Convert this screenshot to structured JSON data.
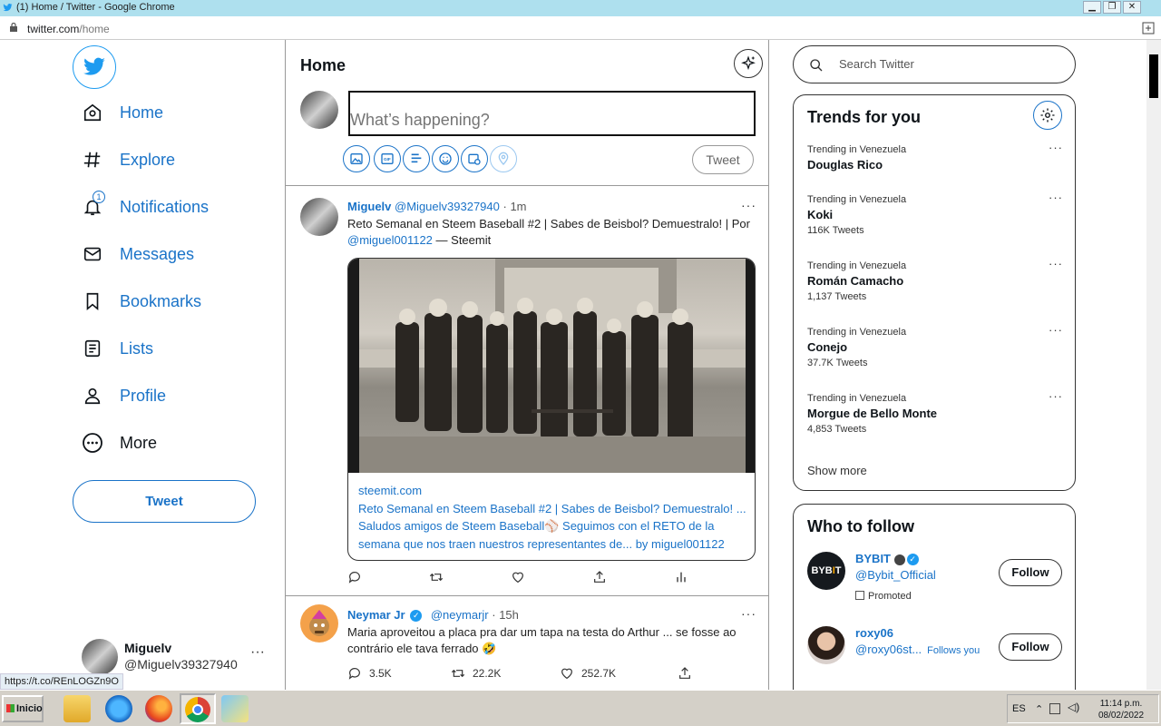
{
  "browser": {
    "window_title": "(1) Home / Twitter - Google Chrome",
    "url_host": "twitter.com",
    "url_path": "/home",
    "status_link": "https://t.co/REnLOGZn9O"
  },
  "colors": {
    "accent": "#1a73c8",
    "twitter_blue": "#1d9bf0",
    "titlebar": "#aee0ee"
  },
  "nav": {
    "items": [
      {
        "label": "Home",
        "icon": "home-icon"
      },
      {
        "label": "Explore",
        "icon": "hashtag-icon"
      },
      {
        "label": "Notifications",
        "icon": "bell-icon",
        "badge": "1"
      },
      {
        "label": "Messages",
        "icon": "envelope-icon"
      },
      {
        "label": "Bookmarks",
        "icon": "bookmark-icon"
      },
      {
        "label": "Lists",
        "icon": "list-icon"
      },
      {
        "label": "Profile",
        "icon": "person-icon"
      },
      {
        "label": "More",
        "icon": "more-circle-icon"
      }
    ],
    "tweet_button": "Tweet",
    "account": {
      "name": "Miguelv",
      "handle": "@Miguelv39327940",
      "menu": "···"
    }
  },
  "timeline": {
    "title": "Home",
    "compose": {
      "placeholder": "What’s happening?",
      "tweet_button": "Tweet"
    },
    "tweets": [
      {
        "name": "Miguelv",
        "handle": "@Miguelv39327940",
        "time": "· 1m",
        "text_main": "Reto Semanal en Steem Baseball #2 | Sabes de Beisbol? Demuestralo! | Por",
        "text_mention": "@miguel001122",
        "text_tail": " — Steemit",
        "card": {
          "domain": "steemit.com",
          "title": "Reto Semanal en Steem Baseball #2 | Sabes de Beisbol? Demuestralo! ...",
          "description": "Saludos amigos de Steem Baseball⚾ Seguimos con el RETO de la semana que nos traen nuestros representantes de... by miguel001122"
        }
      },
      {
        "name": "Neymar Jr",
        "handle": "@neymarjr",
        "time": "· 15h",
        "text_main": "Maria aproveitou a placa pra dar um tapa na testa do Arthur ... se fosse ao contrário ele tava ferrado 🤣",
        "replies": "3.5K",
        "retweets": "22.2K",
        "likes": "252.7K"
      }
    ],
    "more_menu": "···"
  },
  "sidebar": {
    "search_placeholder": "Search Twitter",
    "trends_title": "Trends for you",
    "trends": [
      {
        "context": "Trending in Venezuela",
        "title": "Douglas Rico",
        "count": ""
      },
      {
        "context": "Trending in Venezuela",
        "title": "Koki",
        "count": "116K Tweets"
      },
      {
        "context": "Trending in Venezuela",
        "title": "Román Camacho",
        "count": "1,137 Tweets"
      },
      {
        "context": "Trending in Venezuela",
        "title": "Conejo",
        "count": "37.7K Tweets"
      },
      {
        "context": "Trending in Venezuela",
        "title": "Morgue de Bello Monte",
        "count": "4,853 Tweets"
      }
    ],
    "show_more": "Show more",
    "who_to_follow_title": "Who to follow",
    "suggestions": [
      {
        "name": "BYBIT",
        "handle": "@Bybit_Official",
        "promoted": "Promoted",
        "follow": "Follow"
      },
      {
        "name": "roxy06",
        "handle": "@roxy06st...",
        "follows_you": "Follows you",
        "follow": "Follow"
      }
    ]
  },
  "taskbar": {
    "start": "Inicio",
    "lang": "ES",
    "time": "11:14 p.m.",
    "date": "08/02/2022"
  }
}
